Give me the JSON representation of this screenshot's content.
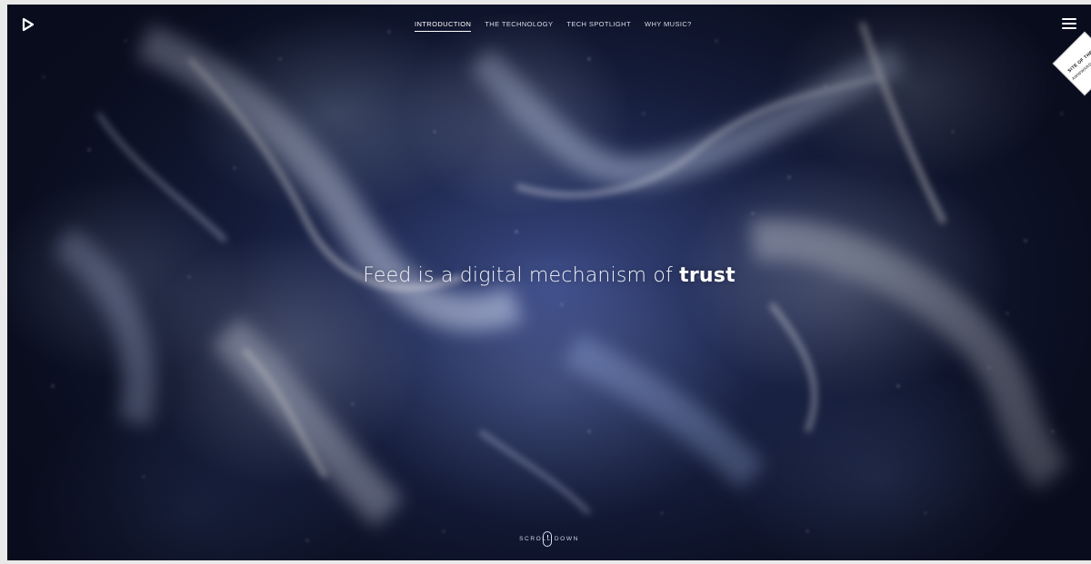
{
  "nav": {
    "items": [
      {
        "label": "INTRODUCTION",
        "active": true
      },
      {
        "label": "THE TECHNOLOGY",
        "active": false
      },
      {
        "label": "TECH SPOTLIGHT",
        "active": false
      },
      {
        "label": "WHY MUSIC?",
        "active": false
      }
    ]
  },
  "hero": {
    "headline_prefix": "Feed is a digital mechanism of ",
    "headline_bold": "trust"
  },
  "scroll": {
    "label": "SCROLL DOWN"
  },
  "award": {
    "line1": "SITE OF THE DAY",
    "line2": "AWWWARDS"
  },
  "icons": {
    "logo": "play-triangle-logo-icon",
    "menu": "hamburger-menu-icon",
    "scroll": "mouse-scroll-icon"
  },
  "colors": {
    "background_dark": "#121a33",
    "accent_white": "#ffffff",
    "nav_text": "#d8dcea"
  }
}
